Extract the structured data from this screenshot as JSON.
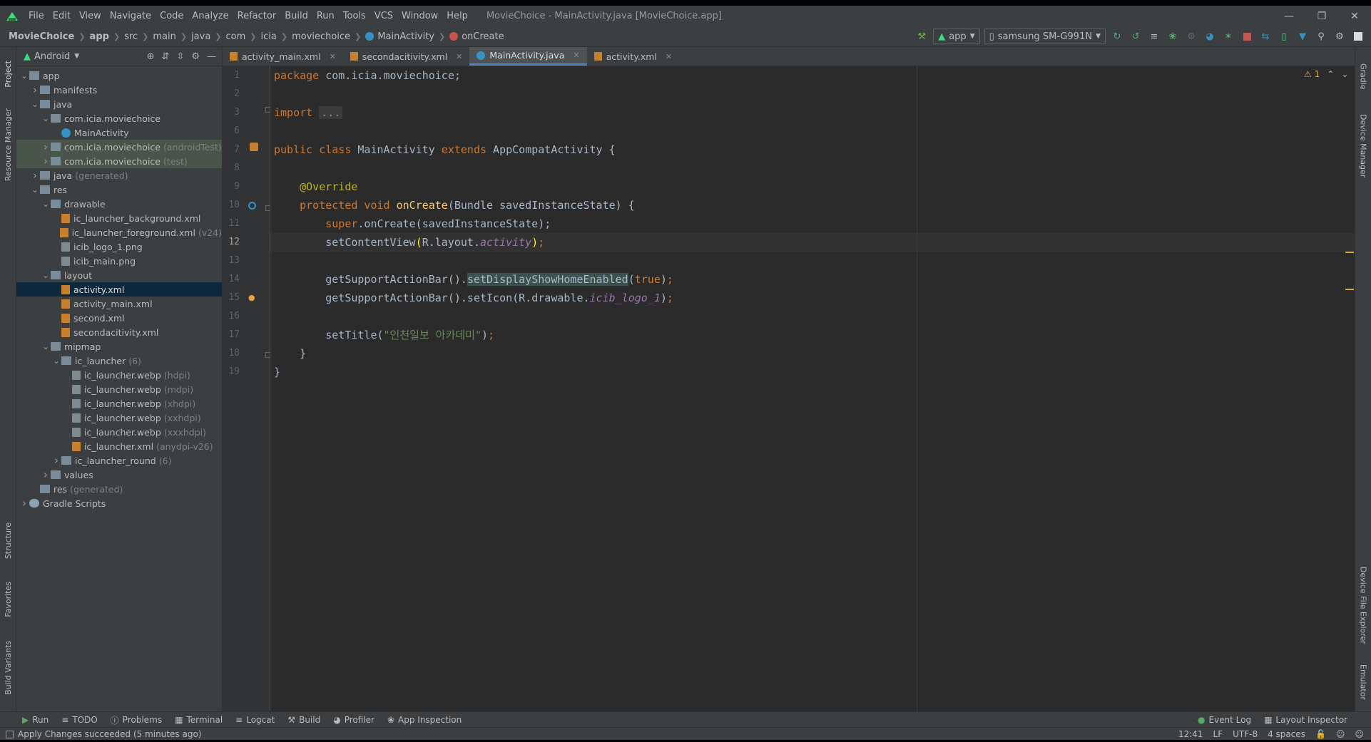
{
  "menu": [
    "File",
    "Edit",
    "View",
    "Navigate",
    "Code",
    "Analyze",
    "Refactor",
    "Build",
    "Run",
    "Tools",
    "VCS",
    "Window",
    "Help"
  ],
  "window_title": "MovieChoice - MainActivity.java [MovieChoice.app]",
  "breadcrumbs": [
    "MovieChoice",
    "app",
    "src",
    "main",
    "java",
    "com",
    "icia",
    "moviechoice",
    "MainActivity",
    "onCreate"
  ],
  "toolbar": {
    "config": "app",
    "device": "samsung SM-G991N"
  },
  "project": {
    "view_mode": "Android",
    "tree": [
      {
        "label": "app",
        "depth": 0,
        "arrow": "down",
        "icon": "folder"
      },
      {
        "label": "manifests",
        "depth": 1,
        "arrow": "right",
        "icon": "folder"
      },
      {
        "label": "java",
        "depth": 1,
        "arrow": "down",
        "icon": "folder"
      },
      {
        "label": "com.icia.moviechoice",
        "depth": 2,
        "arrow": "down",
        "icon": "folder"
      },
      {
        "label": "MainActivity",
        "depth": 3,
        "arrow": "",
        "icon": "class"
      },
      {
        "label": "com.icia.moviechoice",
        "suffix": "(androidTest)",
        "depth": 2,
        "arrow": "right",
        "icon": "folder",
        "style": "tests"
      },
      {
        "label": "com.icia.moviechoice",
        "suffix": "(test)",
        "depth": 2,
        "arrow": "right",
        "icon": "folder",
        "style": "tests"
      },
      {
        "label": "java",
        "suffix": "(generated)",
        "depth": 1,
        "arrow": "right",
        "icon": "folder"
      },
      {
        "label": "res",
        "depth": 1,
        "arrow": "down",
        "icon": "folder"
      },
      {
        "label": "drawable",
        "depth": 2,
        "arrow": "down",
        "icon": "folder"
      },
      {
        "label": "ic_launcher_background.xml",
        "depth": 3,
        "arrow": "",
        "icon": "xml"
      },
      {
        "label": "ic_launcher_foreground.xml",
        "suffix": "(v24)",
        "depth": 3,
        "arrow": "",
        "icon": "xml"
      },
      {
        "label": "icib_logo_1.png",
        "depth": 3,
        "arrow": "",
        "icon": "png"
      },
      {
        "label": "icib_main.png",
        "depth": 3,
        "arrow": "",
        "icon": "png"
      },
      {
        "label": "layout",
        "depth": 2,
        "arrow": "down",
        "icon": "folder"
      },
      {
        "label": "activity.xml",
        "depth": 3,
        "arrow": "",
        "icon": "xml",
        "style": "sel"
      },
      {
        "label": "activity_main.xml",
        "depth": 3,
        "arrow": "",
        "icon": "xml"
      },
      {
        "label": "second.xml",
        "depth": 3,
        "arrow": "",
        "icon": "xml"
      },
      {
        "label": "secondacitivity.xml",
        "depth": 3,
        "arrow": "",
        "icon": "xml"
      },
      {
        "label": "mipmap",
        "depth": 2,
        "arrow": "down",
        "icon": "folder"
      },
      {
        "label": "ic_launcher",
        "suffix": "(6)",
        "depth": 3,
        "arrow": "down",
        "icon": "folder"
      },
      {
        "label": "ic_launcher.webp",
        "suffix": "(hdpi)",
        "depth": 4,
        "arrow": "",
        "icon": "png"
      },
      {
        "label": "ic_launcher.webp",
        "suffix": "(mdpi)",
        "depth": 4,
        "arrow": "",
        "icon": "png"
      },
      {
        "label": "ic_launcher.webp",
        "suffix": "(xhdpi)",
        "depth": 4,
        "arrow": "",
        "icon": "png"
      },
      {
        "label": "ic_launcher.webp",
        "suffix": "(xxhdpi)",
        "depth": 4,
        "arrow": "",
        "icon": "png"
      },
      {
        "label": "ic_launcher.webp",
        "suffix": "(xxxhdpi)",
        "depth": 4,
        "arrow": "",
        "icon": "png"
      },
      {
        "label": "ic_launcher.xml",
        "suffix": "(anydpi-v26)",
        "depth": 4,
        "arrow": "",
        "icon": "xml"
      },
      {
        "label": "ic_launcher_round",
        "suffix": "(6)",
        "depth": 3,
        "arrow": "right",
        "icon": "folder"
      },
      {
        "label": "values",
        "depth": 2,
        "arrow": "right",
        "icon": "folder"
      },
      {
        "label": "res",
        "suffix": "(generated)",
        "depth": 1,
        "arrow": "",
        "icon": "folder"
      },
      {
        "label": "Gradle Scripts",
        "depth": 0,
        "arrow": "right",
        "icon": "gradle"
      }
    ]
  },
  "tabs": [
    {
      "label": "activity_main.xml",
      "active": false
    },
    {
      "label": "secondacitivity.xml",
      "active": false
    },
    {
      "label": "MainActivity.java",
      "active": true
    },
    {
      "label": "activity.xml",
      "active": false
    }
  ],
  "editor": {
    "current_line": 12,
    "warning_count": "1",
    "lines": [
      {
        "n": 1,
        "t": "<span class='kw'>package</span> com.icia.moviechoice;"
      },
      {
        "n": 2,
        "t": ""
      },
      {
        "n": 3,
        "t": "<span class='kw'>import</span> <span class='fold'>...</span>"
      },
      {
        "n": 6,
        "t": ""
      },
      {
        "n": 7,
        "t": "<span class='kw'>public class</span> MainActivity <span class='kw'>extends</span> AppCompatActivity {"
      },
      {
        "n": 8,
        "t": ""
      },
      {
        "n": 9,
        "t": "    <span class='ann'>@Override</span>"
      },
      {
        "n": 10,
        "t": "    <span class='kw'>protected void</span> <span class='fn'>onCreate</span>(Bundle savedInstanceState) {"
      },
      {
        "n": 11,
        "t": "        <span class='kw'>super</span>.onCreate(savedInstanceState);"
      },
      {
        "n": 12,
        "t": "        setContentView<span style='color:#ffef28'>(</span>R.layout.<span class='ital'>activity</span><span style='color:#ffef28'>)</span><span class='kw'>;</span>"
      },
      {
        "n": 13,
        "t": ""
      },
      {
        "n": 14,
        "t": "        getSupportActionBar().<span class='hl'>setDisplayShowHomeEnabled</span>(<span class='kw'>true</span>)<span class='kw'>;</span>"
      },
      {
        "n": 15,
        "t": "        getSupportActionBar().setIcon(R.drawable.<span class='ital'>icib_logo_1</span>)<span class='kw'>;</span>"
      },
      {
        "n": 16,
        "t": ""
      },
      {
        "n": 17,
        "t": "        setTitle(<span class='str'>\"인천일보 아카데미\"</span>)<span class='kw'>;</span>"
      },
      {
        "n": 18,
        "t": "    }"
      },
      {
        "n": 19,
        "t": "}"
      }
    ]
  },
  "left_tools": [
    "Project",
    "Resource Manager",
    "Structure",
    "Favorites",
    "Build Variants"
  ],
  "right_tools": [
    "Gradle",
    "Device Manager",
    "Device File Explorer",
    "Emulator"
  ],
  "bottom_tools": [
    "Run",
    "TODO",
    "Problems",
    "Terminal",
    "Logcat",
    "Build",
    "Profiler",
    "App Inspection"
  ],
  "bottom_right_tools": [
    "Event Log",
    "Layout Inspector"
  ],
  "status": {
    "message": "Apply Changes succeeded (5 minutes ago)",
    "position": "12:41",
    "line_sep": "LF",
    "encoding": "UTF-8",
    "indent": "4 spaces"
  }
}
